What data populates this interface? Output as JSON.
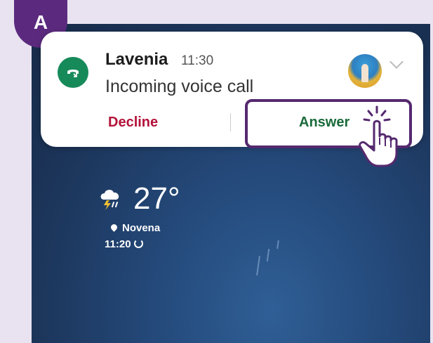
{
  "step_badge": "A",
  "notification": {
    "caller_name": "Lavenia",
    "time": "11:30",
    "subtitle": "Incoming voice call",
    "decline_label": "Decline",
    "answer_label": "Answer",
    "app_icon": "phone-call-icon",
    "expand_icon": "chevron-down-icon"
  },
  "weather": {
    "icon": "thunderstorm-icon",
    "temperature": "27°",
    "location": "Novena",
    "updated_time": "11:20"
  },
  "colors": {
    "badge": "#5b2a7e",
    "highlight_border": "#55296f",
    "decline": "#b3123a",
    "answer": "#1a6a3a",
    "app_icon_bg": "#178a5a"
  }
}
